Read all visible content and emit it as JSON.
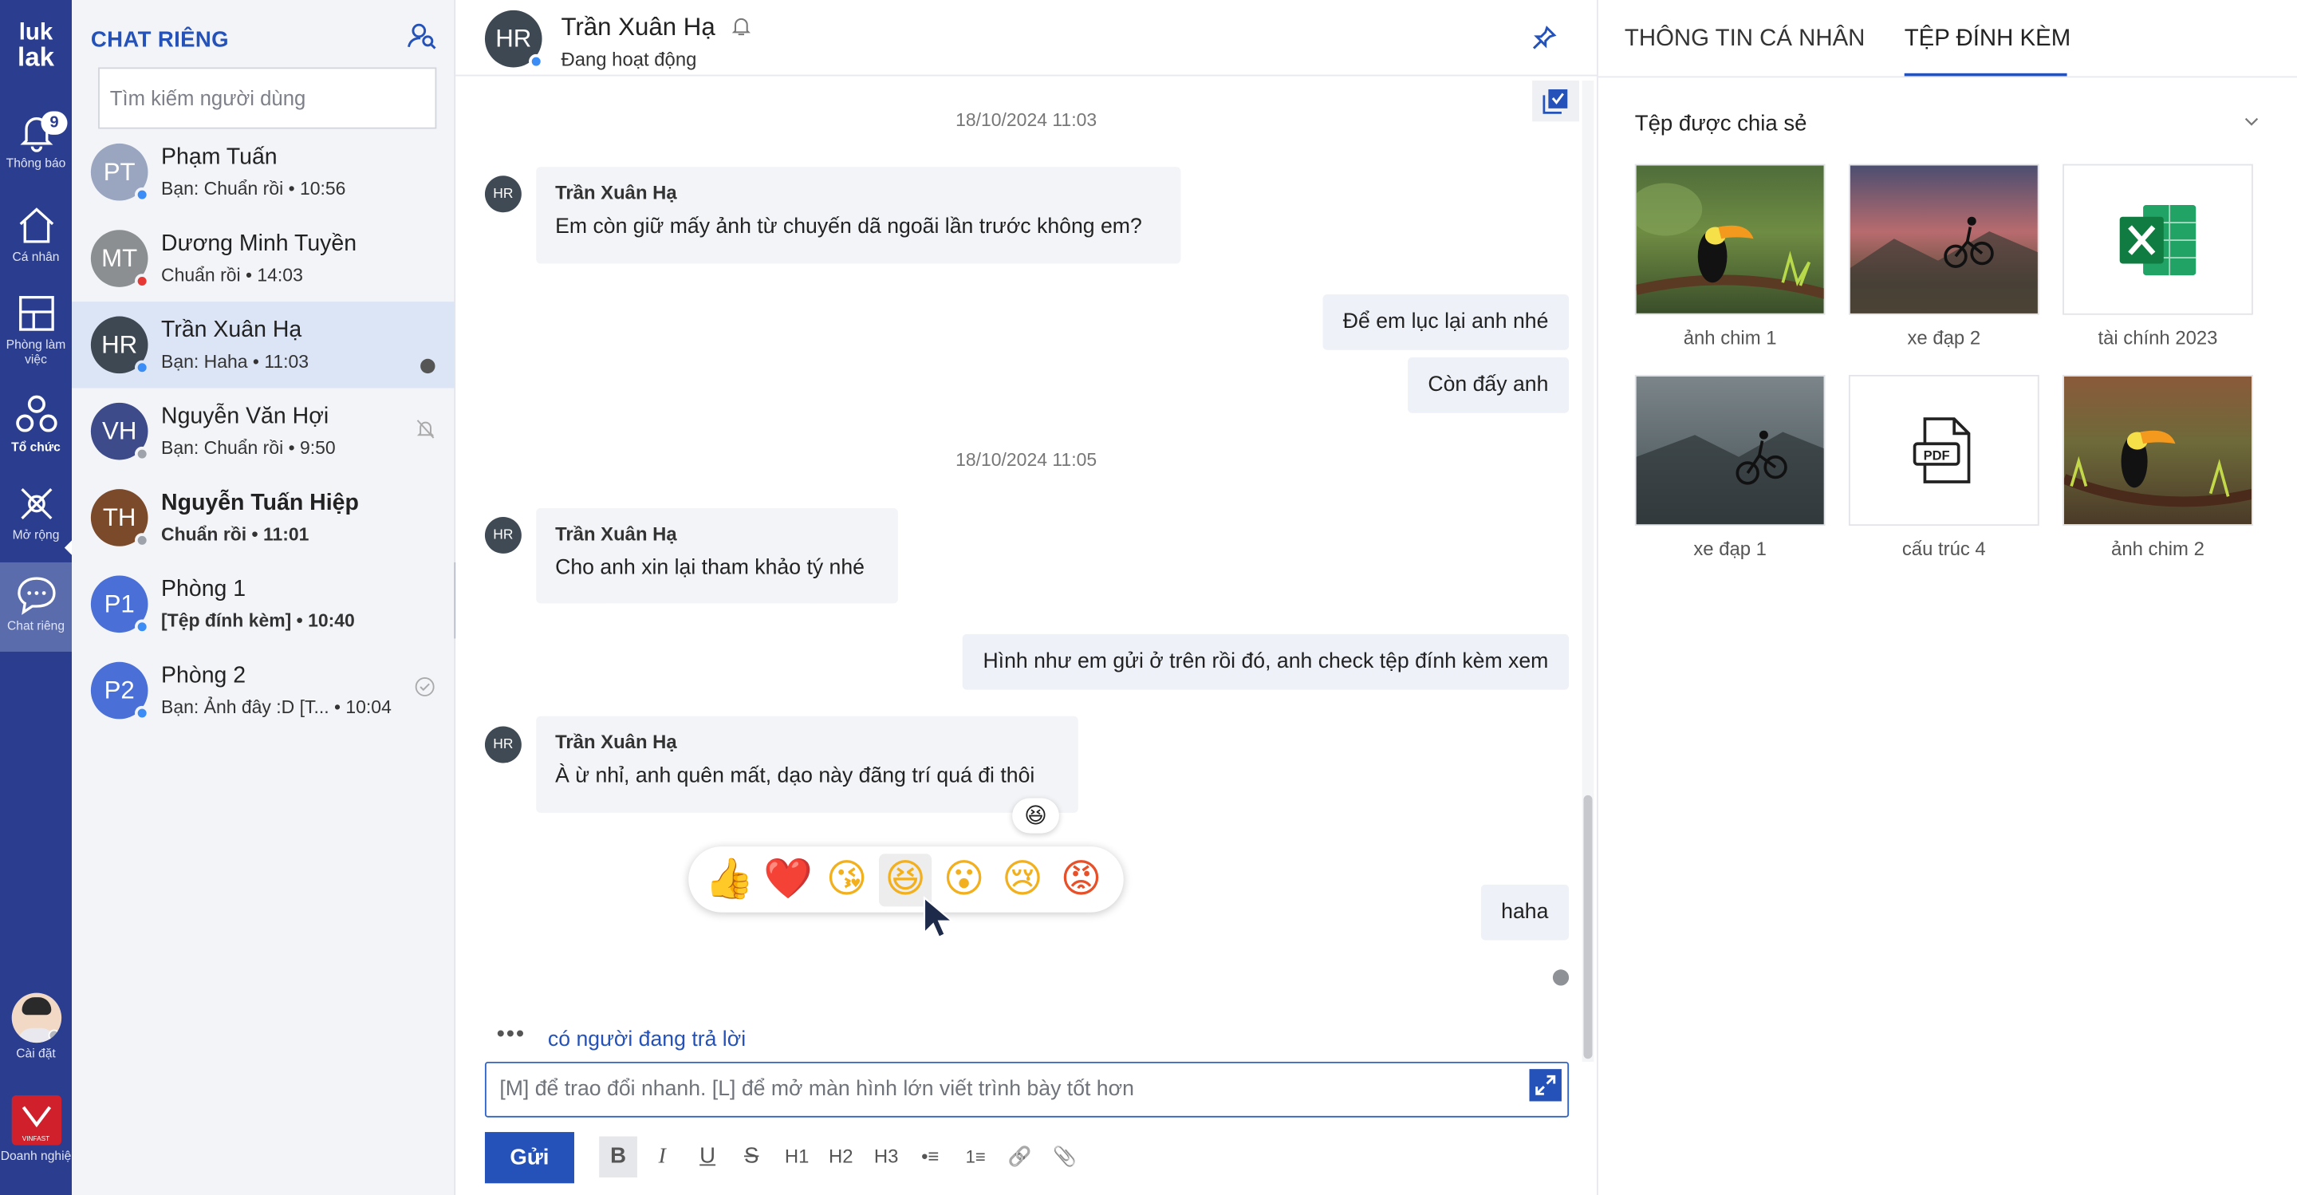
{
  "rail": {
    "logo_top": "luk",
    "logo_bottom": "lak",
    "items": [
      {
        "label": "Thông báo",
        "badge": "9",
        "icon": "bell-icon"
      },
      {
        "label": "Cá nhân",
        "icon": "home-icon"
      },
      {
        "label": "Phòng làm việc",
        "icon": "layout-icon"
      },
      {
        "label": "Tổ chức",
        "icon": "organization-icon"
      },
      {
        "label": "Mở rộng",
        "icon": "extension-icon"
      },
      {
        "label": "Chat riêng",
        "icon": "chat-icon"
      }
    ],
    "settings_label": "Cài đặt",
    "company_label": "Doanh nghiệ",
    "company_logo_text": "VINFAST"
  },
  "list": {
    "title": "CHAT RIÊNG",
    "search_placeholder": "Tìm kiếm người dùng",
    "conversations": [
      {
        "initials": "PT",
        "name": "Phạm Tuấn",
        "sub": "Bạn: Chuẩn rồi  • 10:56",
        "color": "#9aa6c0",
        "status": "#3b8cf5"
      },
      {
        "initials": "MT",
        "name": "Dương Minh Tuyền",
        "sub": "Chuẩn rồi  • 14:03",
        "color": "#8b8f92",
        "status": "#e53935"
      },
      {
        "initials": "HR",
        "name": "Trần Xuân Hạ",
        "sub": "Bạn: Haha  • 11:03",
        "color": "#3d4853",
        "status": "#3b8cf5"
      },
      {
        "initials": "VH",
        "name": "Nguyễn Văn Hợi",
        "sub": "Bạn: Chuẩn rồi  • 9:50",
        "color": "#3d4b8a",
        "status": "#9ea3ab"
      },
      {
        "initials": "TH",
        "name": "Nguyễn Tuấn Hiệp",
        "sub": "Chuẩn rồi  • 11:01",
        "color": "#7b4a2a",
        "status": "#9ea3ab"
      },
      {
        "initials": "P1",
        "name": "Phòng 1",
        "sub": "[Tệp đính kèm]  • 10:40",
        "color": "#4a6fd6",
        "status": "#3b8cf5"
      },
      {
        "initials": "P2",
        "name": "Phòng 2",
        "sub": "Bạn: Ảnh đây :D [T...  • 10:04",
        "color": "#4a6fd6",
        "status": "#3b8cf5"
      }
    ]
  },
  "chat": {
    "initials": "HR",
    "name": "Trần Xuân Hạ",
    "status": "Đang hoạt động",
    "time1": "18/10/2024 11:03",
    "time2": "18/10/2024 11:05",
    "msg1_sender": "Trần Xuân Hạ",
    "msg1_text": "Em còn giữ mấy ảnh từ chuyến dã ngoãi lần trước không em?",
    "out1": "Để em lục lại anh nhé",
    "out2": "Còn đấy anh",
    "msg2_sender": "Trần Xuân Hạ",
    "msg2_text": "Cho anh xin lại tham khảo tý nhé",
    "out3": "Hình như em gửi ở trên rồi đó, anh check tệp đính kèm xem",
    "msg3_sender": "Trần Xuân Hạ",
    "msg3_text": "À ừ nhỉ, anh quên mất, dạo này đãng trí quá đi thôi",
    "msg3_reaction": "😆",
    "out4": "haha",
    "reactions": [
      "👍",
      "❤️",
      "😘",
      "😆",
      "😮",
      "😢",
      "😡"
    ],
    "typing": "có người đang trả lời",
    "compose_placeholder": "[M] để trao đổi nhanh. [L] để mở màn hình lớn viết trình bày tốt hơn",
    "send_label": "Gửi",
    "toolbar": [
      "B",
      "I",
      "U",
      "S",
      "H1",
      "H2",
      "H3",
      "•≡",
      "1≡",
      "🔗",
      "📎"
    ]
  },
  "right": {
    "tab1": "THÔNG TIN CÁ NHÂN",
    "tab2": "TỆP ĐÍNH KÈM",
    "section_title": "Tệp được chia sẻ",
    "files": [
      {
        "name": "ảnh chim 1",
        "kind": "toucan"
      },
      {
        "name": "xe đạp 2",
        "kind": "bike-sunset"
      },
      {
        "name": "tài chính 2023",
        "kind": "excel"
      },
      {
        "name": "xe đạp 1",
        "kind": "bike-gray"
      },
      {
        "name": "cấu trúc 4",
        "kind": "pdf"
      },
      {
        "name": "ảnh chim 2",
        "kind": "toucan"
      }
    ]
  }
}
